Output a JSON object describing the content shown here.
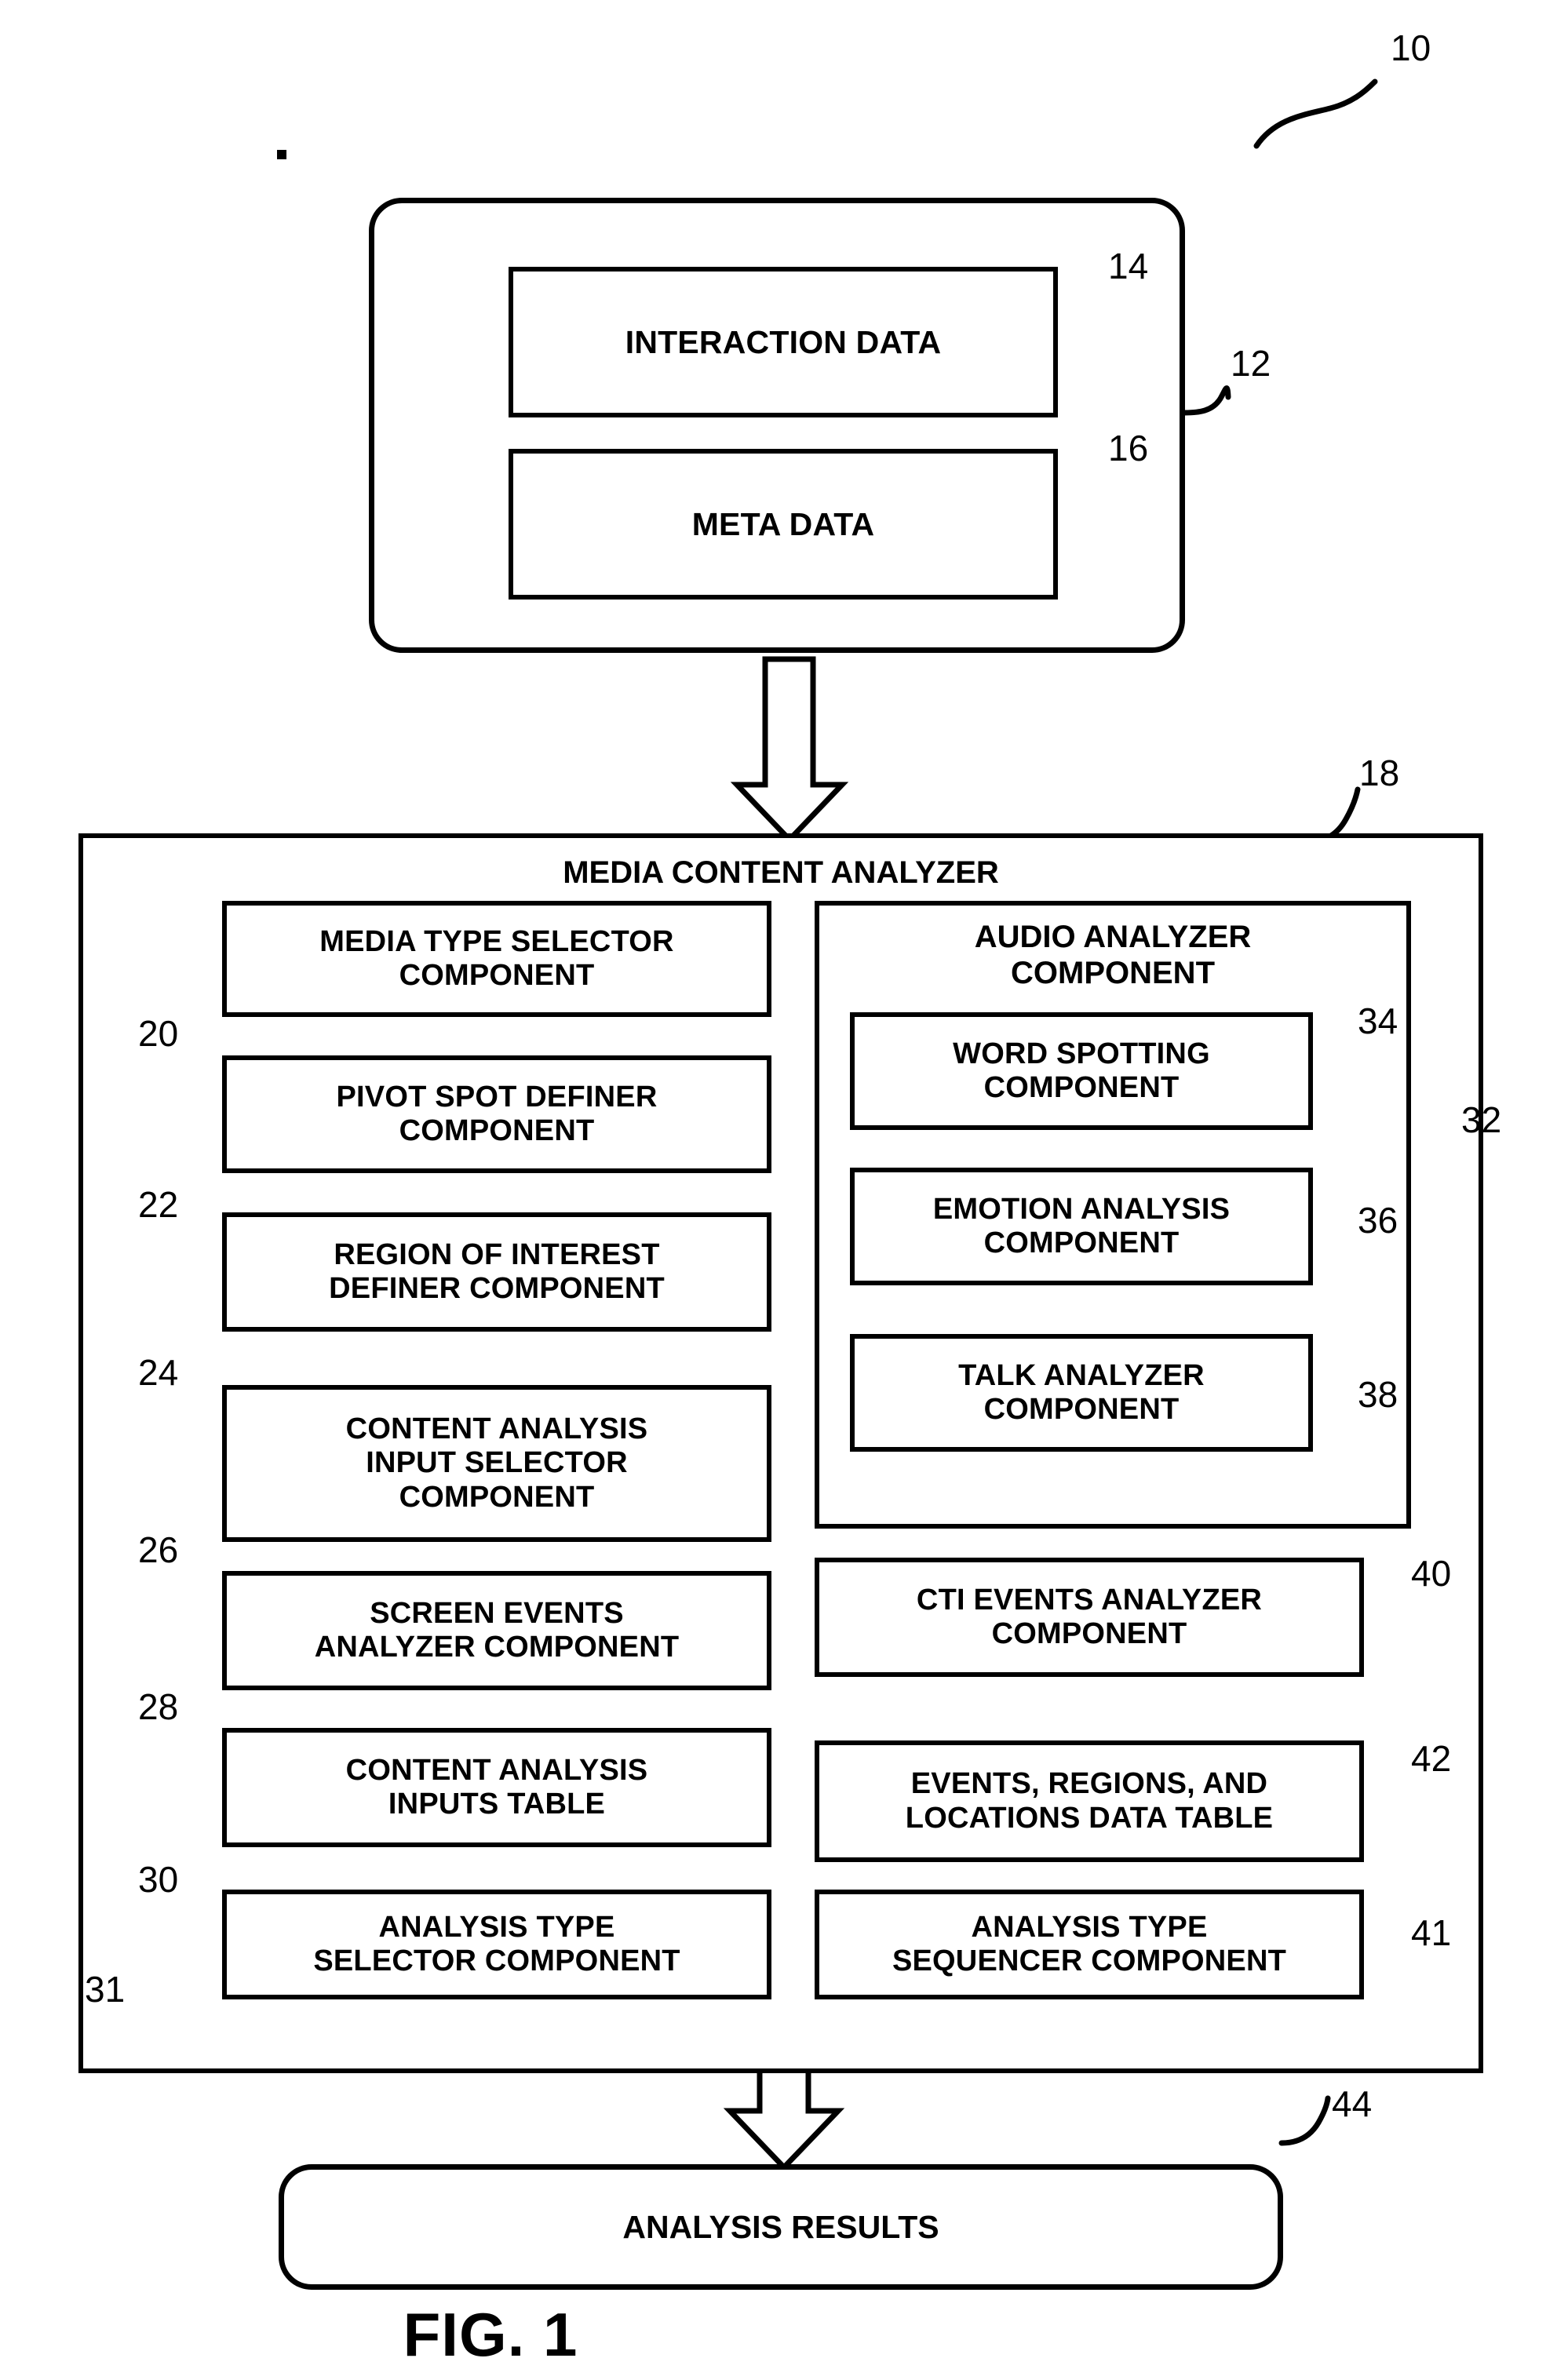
{
  "figure": {
    "caption": "FIG. 1",
    "root_numeral": "10"
  },
  "data_source": {
    "numeral": "12",
    "items": [
      {
        "label": "INTERACTION DATA",
        "numeral": "14"
      },
      {
        "label": "META DATA",
        "numeral": "16"
      }
    ]
  },
  "analyzer": {
    "title": "MEDIA CONTENT ANALYZER",
    "numeral": "18",
    "left_column": [
      {
        "label": "MEDIA TYPE SELECTOR\nCOMPONENT",
        "numeral": "20"
      },
      {
        "label": "PIVOT SPOT DEFINER\nCOMPONENT",
        "numeral": "22"
      },
      {
        "label": "REGION OF INTEREST\nDEFINER COMPONENT",
        "numeral": "24"
      },
      {
        "label": "CONTENT ANALYSIS\nINPUT SELECTOR\nCOMPONENT",
        "numeral": "26"
      },
      {
        "label": "SCREEN EVENTS\nANALYZER COMPONENT",
        "numeral": "28"
      },
      {
        "label": "CONTENT ANALYSIS\nINPUTS TABLE",
        "numeral": "30"
      },
      {
        "label": "ANALYSIS TYPE\nSELECTOR COMPONENT",
        "numeral": "31"
      }
    ],
    "audio_analyzer": {
      "title": "AUDIO ANALYZER\nCOMPONENT",
      "numeral": "32",
      "children": [
        {
          "label": "WORD SPOTTING\nCOMPONENT",
          "numeral": "34"
        },
        {
          "label": "EMOTION ANALYSIS\nCOMPONENT",
          "numeral": "36"
        },
        {
          "label": "TALK ANALYZER\nCOMPONENT",
          "numeral": "38"
        }
      ]
    },
    "right_column": [
      {
        "label": "CTI EVENTS ANALYZER\nCOMPONENT",
        "numeral": "40"
      },
      {
        "label": "EVENTS, REGIONS, AND\nLOCATIONS DATA TABLE",
        "numeral": "42"
      },
      {
        "label": "ANALYSIS TYPE\nSEQUENCER COMPONENT",
        "numeral": "41"
      }
    ]
  },
  "results": {
    "label": "ANALYSIS RESULTS",
    "numeral": "44"
  },
  "colors": {
    "ink": "#000000",
    "paper": "#ffffff"
  }
}
